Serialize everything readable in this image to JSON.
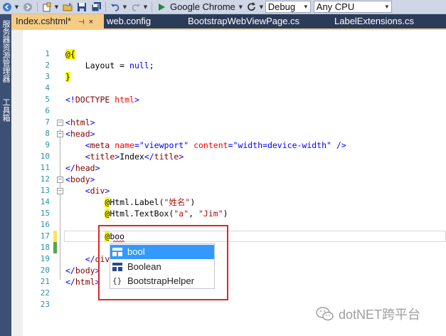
{
  "toolbar": {
    "run_target": "Google Chrome",
    "config": "Debug",
    "platform": "Any CPU"
  },
  "left_panels": [
    "服务器资源管理器",
    "工具箱"
  ],
  "tabs": [
    {
      "label": "Index.cshtml*",
      "active": true,
      "pin": "⊣",
      "close": "×"
    },
    {
      "label": "web.config",
      "active": false
    },
    {
      "label": "BootstrapWebViewPage.cs",
      "active": false
    },
    {
      "label": "LabelExtensions.cs",
      "active": false
    }
  ],
  "editor": {
    "line_numbers": [
      "1",
      "2",
      "3",
      "4",
      "5",
      "6",
      "7",
      "8",
      "9",
      "10",
      "11",
      "12",
      "13",
      "14",
      "15",
      "16",
      "17",
      "18",
      "19",
      "20",
      "21",
      "22",
      "23"
    ],
    "code": {
      "l2_razor": "@{",
      "l3_a": "Layout",
      "l3_b": " = ",
      "l3_c": "null",
      "l3_d": ";",
      "l4_razor": "}",
      "l6_a": "<!",
      "l6_b": "DOCTYPE",
      "l6_c": " ",
      "l6_d": "html",
      "l6_e": ">",
      "l8_a": "<",
      "l8_b": "html",
      "l8_c": ">",
      "l9_a": "<",
      "l9_b": "head",
      "l9_c": ">",
      "l10_a": "<",
      "l10_b": "meta",
      "l10_c": " name",
      "l10_d": "=",
      "l10_e": "\"viewport\"",
      "l10_f": " content",
      "l10_g": "=",
      "l10_h": "\"width=device-width\"",
      "l10_i": " />",
      "l11_a": "<",
      "l11_b": "title",
      "l11_c": ">",
      "l11_d": "Index",
      "l11_e": "</",
      "l11_f": "title",
      "l11_g": ">",
      "l12_a": "</",
      "l12_b": "head",
      "l12_c": ">",
      "l13_a": "<",
      "l13_b": "body",
      "l13_c": ">",
      "l14_a": "<",
      "l14_b": "div",
      "l14_c": ">",
      "l15_razor": "@",
      "l15_a": "Html.Label(",
      "l15_b": "\"姓名\"",
      "l15_c": ")",
      "l16_razor": "@",
      "l16_a": "Html.TextBox(",
      "l16_b": "\"a\"",
      "l16_c": ", ",
      "l16_d": "\"Jim\"",
      "l16_e": ")",
      "l18_razor": "@",
      "l18_a": "boo",
      "l20_a": "</",
      "l20_b": "div",
      "l20_c": ">",
      "l21_a": "</",
      "l21_b": "body",
      "l21_c": ">",
      "l22_a": "</",
      "l22_b": "html",
      "l22_c": ">"
    }
  },
  "intellisense": {
    "items": [
      {
        "label": "bool",
        "icon": "struct-icon",
        "selected": true
      },
      {
        "label": "Boolean",
        "icon": "struct-icon",
        "selected": false
      },
      {
        "label": "BootstrapHelper",
        "icon": "namespace-icon",
        "selected": false
      }
    ],
    "namespace_glyph": "{}"
  },
  "watermark": {
    "text": "dotNET跨平台"
  },
  "colors": {
    "tab_active": "#f5cc84",
    "tab_strip": "#2b3c59",
    "razor_highlight": "#ffff00",
    "selection": "#3399ff",
    "highlight_box": "#e0262b",
    "change_yellow": "#f8e45c",
    "change_green": "#57a64a"
  }
}
